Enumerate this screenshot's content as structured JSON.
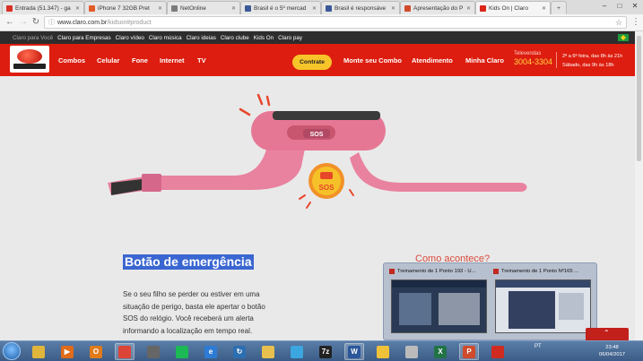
{
  "browser": {
    "tabs": [
      {
        "label": "Entrada (51.347) - ga",
        "favicon_color": "#d93025"
      },
      {
        "label": "iPhone 7 32GB Pret",
        "favicon_color": "#e45b2a"
      },
      {
        "label": "NetOnline",
        "favicon_color": "#7b7b7b"
      },
      {
        "label": "Brasil é o 5º mercad",
        "favicon_color": "#3b5998"
      },
      {
        "label": "Brasil é responsáve",
        "favicon_color": "#3b5998"
      },
      {
        "label": "Apresentação do P",
        "favicon_color": "#d04a2c"
      },
      {
        "label": "Kids On | Claro",
        "favicon_color": "#da2518"
      }
    ],
    "new_tab_symbol": "+",
    "window_controls": {
      "minimize": "–",
      "maximize": "□",
      "close": "✕"
    },
    "nav": {
      "back": "←",
      "forward": "→",
      "reload": "↻"
    },
    "url_host": "www.claro.com.br",
    "url_path": "/kidson#product",
    "star": "☆",
    "menu": "⋮"
  },
  "site": {
    "topbar": {
      "prefix": "Claro para Você",
      "links": [
        "Claro para Empresas",
        "Claro vídeo",
        "Claro música",
        "Claro ideias",
        "Claro clube",
        "Kids On",
        "Claro pay"
      ]
    },
    "menu": [
      "Combos",
      "Celular",
      "Fone",
      "Internet",
      "TV"
    ],
    "contrate": "Contrate",
    "menu_right": [
      "Monte seu Combo",
      "Atendimento",
      "Minha Claro"
    ],
    "telephone_label": "Televendas",
    "telephone": "3004-3304",
    "hours_line1": "2ª a 6ª feira, das 8h às 21h",
    "hours_line2": "Sábado, das 9h às 18h",
    "sos_label": "SOS",
    "colors": {
      "brand_red": "#dd1d0f",
      "yellow": "#f7c52a",
      "watch_pink": "#e9829f"
    }
  },
  "content": {
    "heading": "Botão de emergência",
    "paragraph": "Se o seu filho se perder ou estiver em uma situação de perigo, basta ele apertar o botão SOS do relógio. Você receberá um alerta informando a localização em tempo real.",
    "side_title": "Como acontece?"
  },
  "preview": [
    {
      "title": "Treinamento de 1 Ponto 193 - U..."
    },
    {
      "title": "Treinamento de 1 Ponto Nº165 ..."
    }
  ],
  "taskbar": {
    "apps": [
      {
        "name": "explorer-icon",
        "glyph": "",
        "color": "#e0b53c"
      },
      {
        "name": "media-player-icon",
        "glyph": "▶",
        "color": "#e06b1a"
      },
      {
        "name": "outlook-icon",
        "glyph": "O",
        "color": "#e07b1a"
      },
      {
        "name": "chrome-icon",
        "glyph": "",
        "color": "#dc4438"
      },
      {
        "name": "app-icon",
        "glyph": "",
        "color": "#666"
      },
      {
        "name": "spotify-icon",
        "glyph": "",
        "color": "#1db954"
      },
      {
        "name": "ie-icon",
        "glyph": "e",
        "color": "#2d7bd5"
      },
      {
        "name": "refresh-app-icon",
        "glyph": "↻",
        "color": "#2c6fb1"
      },
      {
        "name": "folder-icon",
        "glyph": "",
        "color": "#e8c04d"
      },
      {
        "name": "chat-icon",
        "glyph": "",
        "color": "#3ca6e0"
      },
      {
        "name": "7zip-icon",
        "glyph": "7z",
        "color": "#222"
      },
      {
        "name": "word-icon",
        "glyph": "W",
        "color": "#2b579a"
      },
      {
        "name": "lock-icon",
        "glyph": "",
        "color": "#f0c23a"
      },
      {
        "name": "calculator-icon",
        "glyph": "",
        "color": "#bbb"
      },
      {
        "name": "excel-icon",
        "glyph": "X",
        "color": "#217346"
      },
      {
        "name": "powerpoint-icon",
        "glyph": "P",
        "color": "#d04a2c"
      },
      {
        "name": "acrobat-icon",
        "glyph": "",
        "color": "#d02b20"
      }
    ],
    "tray_text": "PT",
    "time": "23:48",
    "date": "06/04/2017"
  }
}
